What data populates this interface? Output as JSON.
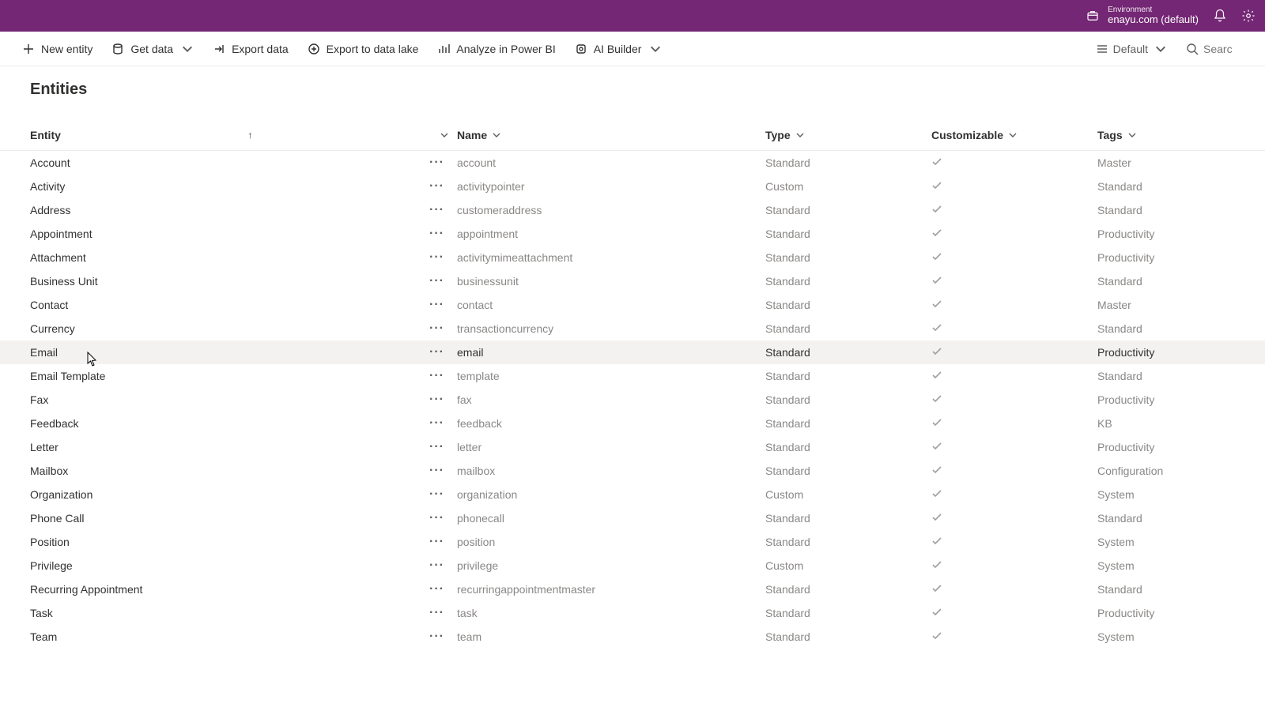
{
  "topbar": {
    "env_label": "Environment",
    "env_name": "enayu.com (default)"
  },
  "cmdbar": {
    "new_entity": "New entity",
    "get_data": "Get data",
    "export_data": "Export data",
    "export_lake": "Export to data lake",
    "analyze_bi": "Analyze in Power BI",
    "ai_builder": "AI Builder",
    "view_mode": "Default",
    "search_placeholder": "Searc"
  },
  "page": {
    "title": "Entities"
  },
  "columns": {
    "entity": "Entity",
    "name": "Name",
    "type": "Type",
    "customizable": "Customizable",
    "tags": "Tags"
  },
  "rows": [
    {
      "entity": "Account",
      "name": "account",
      "type": "Standard",
      "customizable": true,
      "tags": "Master"
    },
    {
      "entity": "Activity",
      "name": "activitypointer",
      "type": "Custom",
      "customizable": true,
      "tags": "Standard"
    },
    {
      "entity": "Address",
      "name": "customeraddress",
      "type": "Standard",
      "customizable": true,
      "tags": "Standard"
    },
    {
      "entity": "Appointment",
      "name": "appointment",
      "type": "Standard",
      "customizable": true,
      "tags": "Productivity"
    },
    {
      "entity": "Attachment",
      "name": "activitymimeattachment",
      "type": "Standard",
      "customizable": true,
      "tags": "Productivity"
    },
    {
      "entity": "Business Unit",
      "name": "businessunit",
      "type": "Standard",
      "customizable": true,
      "tags": "Standard"
    },
    {
      "entity": "Contact",
      "name": "contact",
      "type": "Standard",
      "customizable": true,
      "tags": "Master"
    },
    {
      "entity": "Currency",
      "name": "transactioncurrency",
      "type": "Standard",
      "customizable": true,
      "tags": "Standard"
    },
    {
      "entity": "Email",
      "name": "email",
      "type": "Standard",
      "customizable": true,
      "tags": "Productivity",
      "hovered": true
    },
    {
      "entity": "Email Template",
      "name": "template",
      "type": "Standard",
      "customizable": true,
      "tags": "Standard"
    },
    {
      "entity": "Fax",
      "name": "fax",
      "type": "Standard",
      "customizable": true,
      "tags": "Productivity"
    },
    {
      "entity": "Feedback",
      "name": "feedback",
      "type": "Standard",
      "customizable": true,
      "tags": "KB"
    },
    {
      "entity": "Letter",
      "name": "letter",
      "type": "Standard",
      "customizable": true,
      "tags": "Productivity"
    },
    {
      "entity": "Mailbox",
      "name": "mailbox",
      "type": "Standard",
      "customizable": true,
      "tags": "Configuration"
    },
    {
      "entity": "Organization",
      "name": "organization",
      "type": "Custom",
      "customizable": true,
      "tags": "System"
    },
    {
      "entity": "Phone Call",
      "name": "phonecall",
      "type": "Standard",
      "customizable": true,
      "tags": "Standard"
    },
    {
      "entity": "Position",
      "name": "position",
      "type": "Standard",
      "customizable": true,
      "tags": "System"
    },
    {
      "entity": "Privilege",
      "name": "privilege",
      "type": "Custom",
      "customizable": true,
      "tags": "System"
    },
    {
      "entity": "Recurring Appointment",
      "name": "recurringappointmentmaster",
      "type": "Standard",
      "customizable": true,
      "tags": "Standard"
    },
    {
      "entity": "Task",
      "name": "task",
      "type": "Standard",
      "customizable": true,
      "tags": "Productivity"
    },
    {
      "entity": "Team",
      "name": "team",
      "type": "Standard",
      "customizable": true,
      "tags": "System"
    }
  ]
}
